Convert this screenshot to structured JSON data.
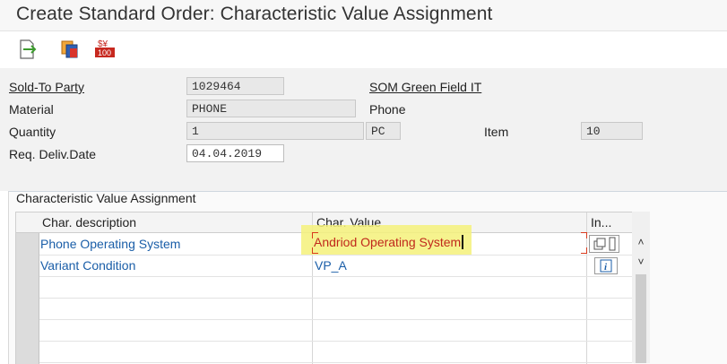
{
  "window": {
    "title": "Create Standard Order: Characteristic Value Assignment"
  },
  "toolbar": {
    "buttons": [
      {
        "icon": "exit-icon",
        "label": ""
      },
      {
        "icon": "copy-icon",
        "label": ""
      },
      {
        "icon": "price-icon",
        "label": "100"
      }
    ]
  },
  "header": {
    "sold_to": {
      "label": "Sold-To Party",
      "value": "1029464",
      "desc": "SOM Green Field IT"
    },
    "material": {
      "label": "Material",
      "value": "PHONE",
      "desc": "Phone"
    },
    "quantity": {
      "label": "Quantity",
      "value": "1",
      "unit": "PC"
    },
    "item": {
      "label": "Item",
      "value": "10"
    },
    "req_deliv": {
      "label": "Req. Deliv.Date",
      "value": "04.04.2019"
    }
  },
  "section": {
    "title": "Characteristic Value Assignment",
    "columns": {
      "desc": "Char. description",
      "value": "Char. Value",
      "info": "In..."
    },
    "rows": [
      {
        "desc": "Phone Operating System",
        "value": "Andriod Operating System"
      },
      {
        "desc": "Variant Condition",
        "value": "VP_A"
      }
    ]
  },
  "colors": {
    "link": "#1a5ea8",
    "active_value": "#c0281c",
    "highlight": "#f4f17a"
  }
}
